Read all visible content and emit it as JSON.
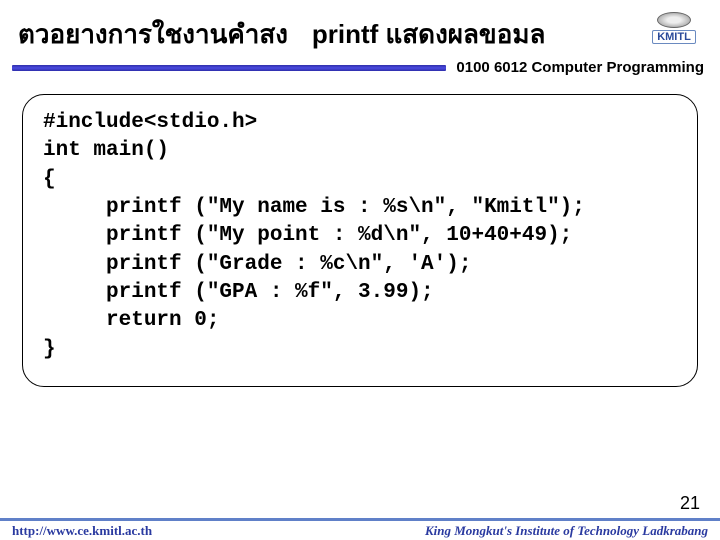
{
  "header": {
    "title_left": "ตวอยางการใชงานคำสง",
    "title_right_bold": "printf",
    "title_right_rest": " แสดงผลขอมล"
  },
  "course_label": "0100 6012 Computer Programming",
  "logo": {
    "text": "KMITL"
  },
  "code": {
    "lines": [
      "#include<stdio.h>",
      "int main()",
      "{",
      "     printf (\"My name is : %s\\n\", \"Kmitl\");",
      "     printf (\"My point : %d\\n\", 10+40+49);",
      "     printf (\"Grade : %c\\n\", 'A');",
      "     printf (\"GPA : %f\", 3.99);",
      "     return 0;",
      "}"
    ]
  },
  "page_number": "21",
  "footer": {
    "left": "http://www.ce.kmitl.ac.th",
    "right": "King Mongkut's Institute of Technology Ladkrabang"
  }
}
